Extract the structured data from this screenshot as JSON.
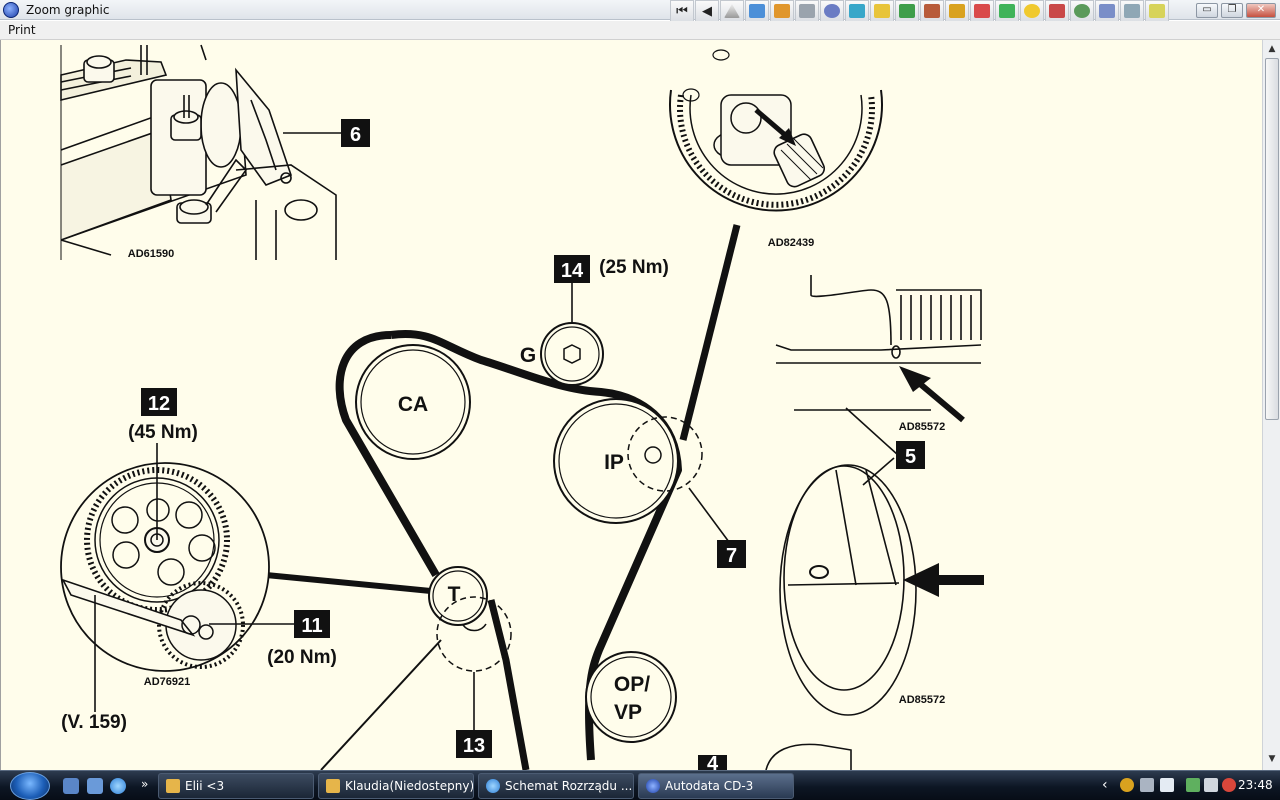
{
  "window": {
    "title": "Zoom graphic",
    "menu": {
      "print": "Print"
    },
    "controls": {
      "minimize": "▭",
      "maximize": "❐",
      "close": "✕"
    }
  },
  "toolbar": {
    "first_icon": "first-page-icon",
    "prev_icon": "prev-page-icon",
    "first_glyph": "⏮",
    "prev_glyph": "◀",
    "tool_icons": [
      "warning-icon",
      "info-icon",
      "engine-icon",
      "wrench-icon",
      "tyre-icon",
      "fluid-icon",
      "battery-icon",
      "fuel-icon",
      "gauge-icon",
      "key-icon",
      "hazard-icon",
      "aircon-icon",
      "airbag-icon",
      "oil-icon",
      "service-icon",
      "tools-icon",
      "lamp-icon",
      "timing-icon",
      "document-icon"
    ]
  },
  "diagram": {
    "codes": {
      "camshaft_inset": "AD61590",
      "sprocket_inset": "AD82439",
      "tensioner_inset": "AD76921",
      "mark_inset_top": "AD85572",
      "mark_inset_bottom": "AD85572"
    },
    "callouts": {
      "c4": "4",
      "c5": "5",
      "c6": "6",
      "c7": "7",
      "c11": "11",
      "c12": "12",
      "c13": "13",
      "c14": "14"
    },
    "torques": {
      "t14": "(25 Nm)",
      "t12": "(45 Nm)",
      "t11": "(20 Nm)"
    },
    "tool_ref": "(V. 159)",
    "pulleys": {
      "camshaft": "CA",
      "injection_pump": "IP",
      "idler": "G",
      "tensioner": "T",
      "oil_pump_line1": "OP/",
      "oil_pump_line2": "VP"
    }
  },
  "taskbar": {
    "buttons": [
      {
        "label": "Elii <3",
        "icon": "mail-icon"
      },
      {
        "label": "Klaudia(Niedostepny)",
        "icon": "mail-icon"
      },
      {
        "label": "Schemat Rozrządu ...",
        "icon": "ie-icon"
      },
      {
        "label": "Autodata CD-3",
        "icon": "autodata-icon"
      }
    ],
    "clock": "23:48",
    "tray_arrow": "‹",
    "ql_more": "»"
  },
  "colors": {
    "diagram_bg": "#fffdeb",
    "callout_box": "#111111",
    "taskbar": "#0d1624"
  }
}
